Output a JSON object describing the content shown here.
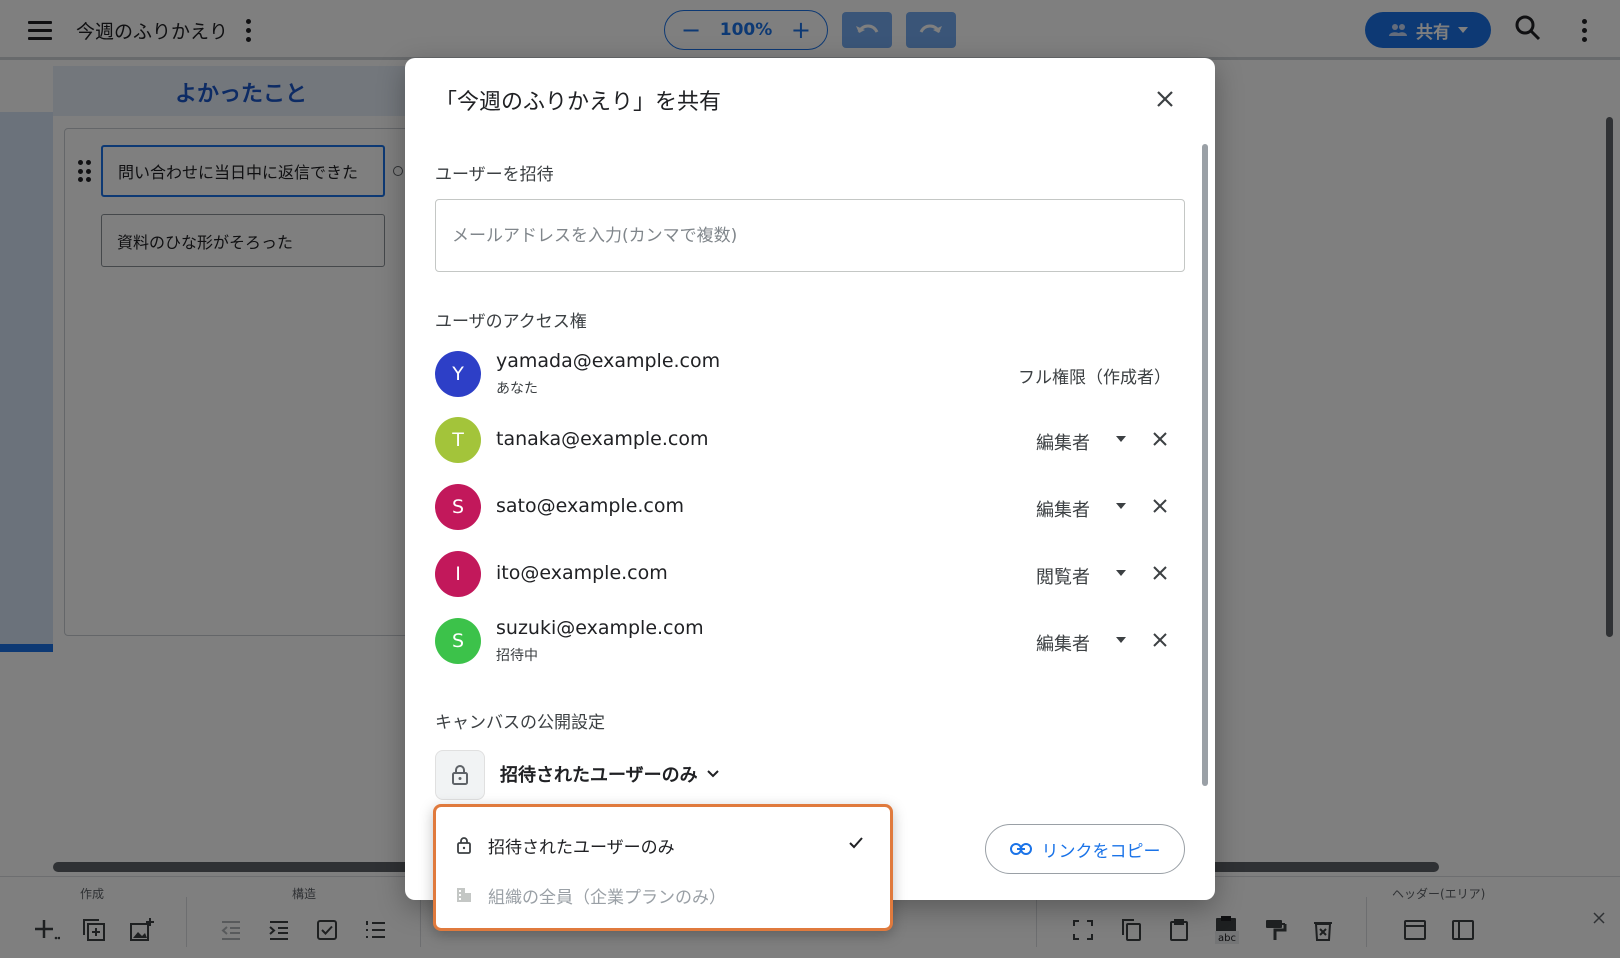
{
  "app": {
    "doc_title": "今週のふりかえり",
    "zoom": {
      "minus": "−",
      "value": "100%",
      "plus": "+"
    },
    "share_label": "共有",
    "icons": [
      "menu-icon",
      "more-vert-icon",
      "undo-icon",
      "redo-icon",
      "people-icon",
      "search-icon"
    ]
  },
  "board": {
    "column_title": "よかったこと",
    "cards": [
      "問い合わせに当日中に返信できた",
      "資料のひな形がそろった"
    ]
  },
  "toolbar": {
    "groups": [
      "作成",
      "構造",
      "ヘッダー(エリア)"
    ]
  },
  "dialog": {
    "title": "「今週のふりかえり」を共有",
    "invite_label": "ユーザーを招待",
    "invite_placeholder": "メールアドレスを入力(カンマで複数)",
    "access_label": "ユーザのアクセス権",
    "users": [
      {
        "initial": "Y",
        "email": "yamada@example.com",
        "sub": "あなた",
        "role": "フル権限（作成者）",
        "color": "#2d3fc7"
      },
      {
        "initial": "T",
        "email": "tanaka@example.com",
        "sub": "",
        "role": "編集者",
        "color": "#a3c43a"
      },
      {
        "initial": "S",
        "email": "sato@example.com",
        "sub": "",
        "role": "編集者",
        "color": "#c2185b"
      },
      {
        "initial": "I",
        "email": "ito@example.com",
        "sub": "",
        "role": "閲覧者",
        "color": "#c2185b"
      },
      {
        "initial": "S",
        "email": "suzuki@example.com",
        "sub": "招待中",
        "role": "編集者",
        "color": "#3cc24a"
      }
    ],
    "visibility_label": "キャンバスの公開設定",
    "visibility_value": "招待されたユーザーのみ",
    "copy_link_label": "リンクをコピー",
    "visibility_options": [
      {
        "label": "招待されたユーザーのみ",
        "selected": true,
        "disabled": false
      },
      {
        "label": "組織の全員（企業プランのみ）",
        "selected": false,
        "disabled": true
      }
    ],
    "accent_color": "#1a73e8",
    "highlight_color": "#e07a3d"
  }
}
